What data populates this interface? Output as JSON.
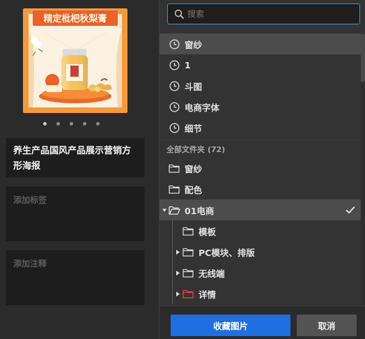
{
  "preview": {
    "poster_title": "精定枇杷秋梨膏",
    "carousel_count": 5,
    "carousel_active_index": 0
  },
  "asset": {
    "title": "养生产品国风产品展示营销方形海报",
    "tag_placeholder": "添加标签",
    "note_placeholder": "添加注释"
  },
  "search": {
    "placeholder": "搜索",
    "value": ""
  },
  "recent": [
    {
      "label": "窗纱",
      "icon": "clock-icon"
    },
    {
      "label": "1",
      "icon": "clock-icon"
    },
    {
      "label": "斗图",
      "icon": "clock-icon"
    },
    {
      "label": "电商字体",
      "icon": "clock-icon"
    },
    {
      "label": "细节",
      "icon": "clock-icon"
    }
  ],
  "folders_header": "全部文件夹 (72)",
  "folders": [
    {
      "label": "窗纱",
      "icon": "folder-icon"
    },
    {
      "label": "配色",
      "icon": "folder-icon"
    },
    {
      "label": "01电商",
      "icon": "folder-open-icon",
      "expanded": true,
      "checked": true
    },
    {
      "label": "模板",
      "icon": "folder-icon",
      "level": 1
    },
    {
      "label": "PC模块、排版",
      "icon": "folder-icon",
      "level": 1,
      "has_children": true
    },
    {
      "label": "无线端",
      "icon": "folder-icon",
      "level": 1,
      "has_children": true
    },
    {
      "label": "详情",
      "icon": "folder-icon",
      "level": 1,
      "has_children": true,
      "color": "#e0454b"
    }
  ],
  "buttons": {
    "collect_label": "收藏图片",
    "cancel_label": "取消"
  },
  "colors": {
    "accent": "#1e6fe0",
    "search_border": "#3b8ae9",
    "selected_row": "#4c4c4c",
    "poster_orange": "#f39a3c"
  }
}
